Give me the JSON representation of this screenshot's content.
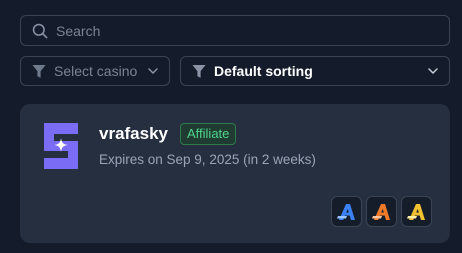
{
  "search": {
    "placeholder": "Search",
    "icon": "search-icon"
  },
  "filters": {
    "casino": {
      "label": "Select casino",
      "icon": "funnel-icon"
    },
    "sorting": {
      "label": "Default sorting",
      "icon": "funnel-icon"
    }
  },
  "card": {
    "logo_icon": "streamer-s-logo",
    "username": "vrafasky",
    "badge": "Affiliate",
    "expires": "Expires on Sep 9, 2025 (in 2 weeks)",
    "bonus_icons": [
      {
        "name": "bonus-a-icon",
        "color": "#3b82f6"
      },
      {
        "name": "bonus-a-icon",
        "color": "#f07a2a"
      },
      {
        "name": "bonus-a-icon",
        "color": "#f0c030"
      }
    ]
  },
  "colors": {
    "background": "#141c2b",
    "card": "#252f40",
    "accent": "#7b6cf6",
    "badge_green": "#4fd68a"
  }
}
